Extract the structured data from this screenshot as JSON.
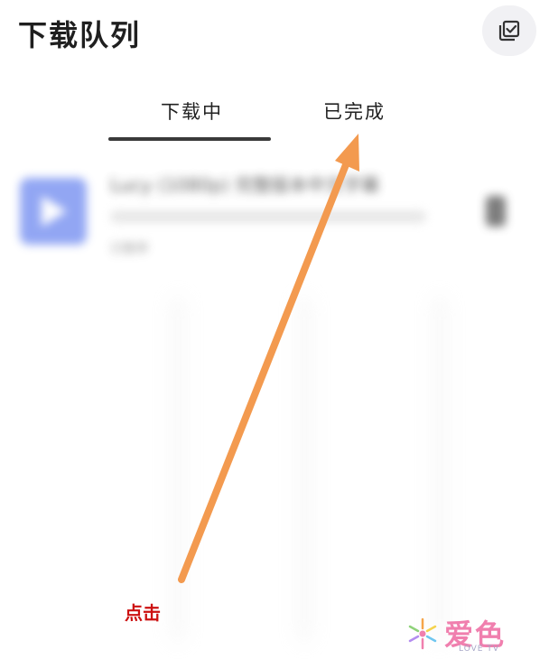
{
  "header": {
    "title": "下载队列",
    "select_icon": "checkbox-stack-icon"
  },
  "tabs": [
    {
      "label": "下载中",
      "active": true
    },
    {
      "label": "已完成",
      "active": false
    }
  ],
  "list": {
    "items": [
      {
        "title": "Lucy (1080p) 完整版本中文字幕",
        "status": "已暂停",
        "thumb_color": "#7f97f2",
        "thumb_icon": "play-icon",
        "action_icon": "pause-icon"
      }
    ]
  },
  "annotation": {
    "click_text": "点击",
    "arrow_color": "#f39a4f",
    "text_color": "#cc1111"
  },
  "watermark": {
    "logo_icon": "snowflake-logo-icon",
    "text": "爱色",
    "subtext": "LOVE TV"
  }
}
